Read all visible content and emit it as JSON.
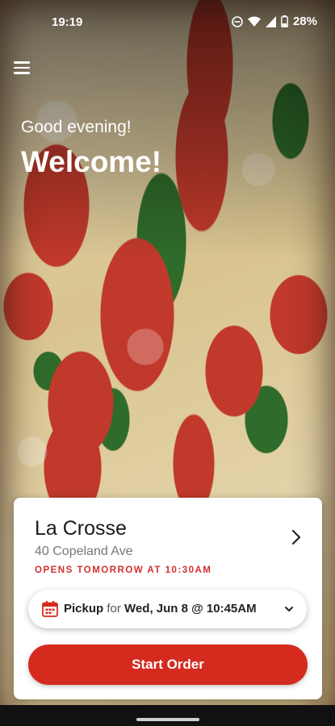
{
  "status_bar": {
    "time": "19:19",
    "battery": "28%",
    "icons": [
      "do-not-disturb-icon",
      "wifi-icon",
      "signal-icon",
      "battery-icon"
    ]
  },
  "header": {
    "greeting": "Good evening!",
    "welcome": "Welcome!"
  },
  "store_card": {
    "name": "La Crosse",
    "address": "40 Copeland Ave",
    "status": "OPENS TOMORROW AT 10:30AM",
    "pickup": {
      "mode": "Pickup",
      "connector": "for",
      "datetime": "Wed, Jun 8 @ 10:45AM"
    },
    "start_order_label": "Start Order"
  },
  "colors": {
    "accent": "#d52b1e",
    "status_text": "#d32f2f"
  }
}
